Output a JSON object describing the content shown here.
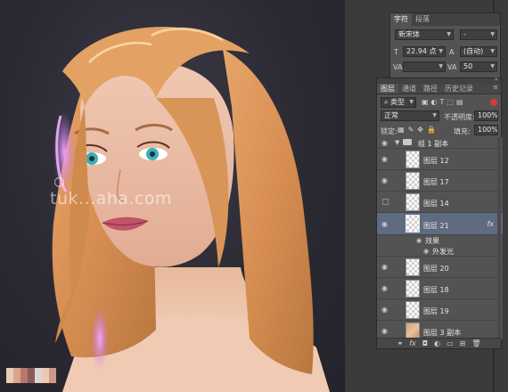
{
  "watermark": "tuk...aha.com",
  "swatches": [
    "#e9cbb6",
    "#d9a58b",
    "#b8796a",
    "#8a5c58",
    "#dcd7d4",
    "#f0c6b6",
    "#c99a8a"
  ],
  "character_panel": {
    "tabs": [
      "字符",
      "段落"
    ],
    "font_family": "新宋体",
    "font_style": "-",
    "font_size": "22.94 点",
    "leading": "(自动)",
    "kerning": "",
    "tracking": "50"
  },
  "layers_panel": {
    "tabs": [
      "图层",
      "通道",
      "路径",
      "历史记录"
    ],
    "filter_kind": "类型",
    "blend_mode": "正常",
    "opacity_label": "不透明度:",
    "opacity_value": "100%",
    "lock_label": "锁定:",
    "fill_label": "填充:",
    "fill_value": "100%",
    "group_name": "组 1 副本",
    "layers": [
      {
        "name": "图层 12"
      },
      {
        "name": "图层 17"
      },
      {
        "name": "图层 14"
      },
      {
        "name": "图层 21",
        "fx": "fx"
      },
      {
        "name": "效果"
      },
      {
        "name": "外发光"
      },
      {
        "name": "图层 20"
      },
      {
        "name": "图层 18"
      },
      {
        "name": "图层 19"
      },
      {
        "name": "图层 3 副本"
      }
    ]
  }
}
